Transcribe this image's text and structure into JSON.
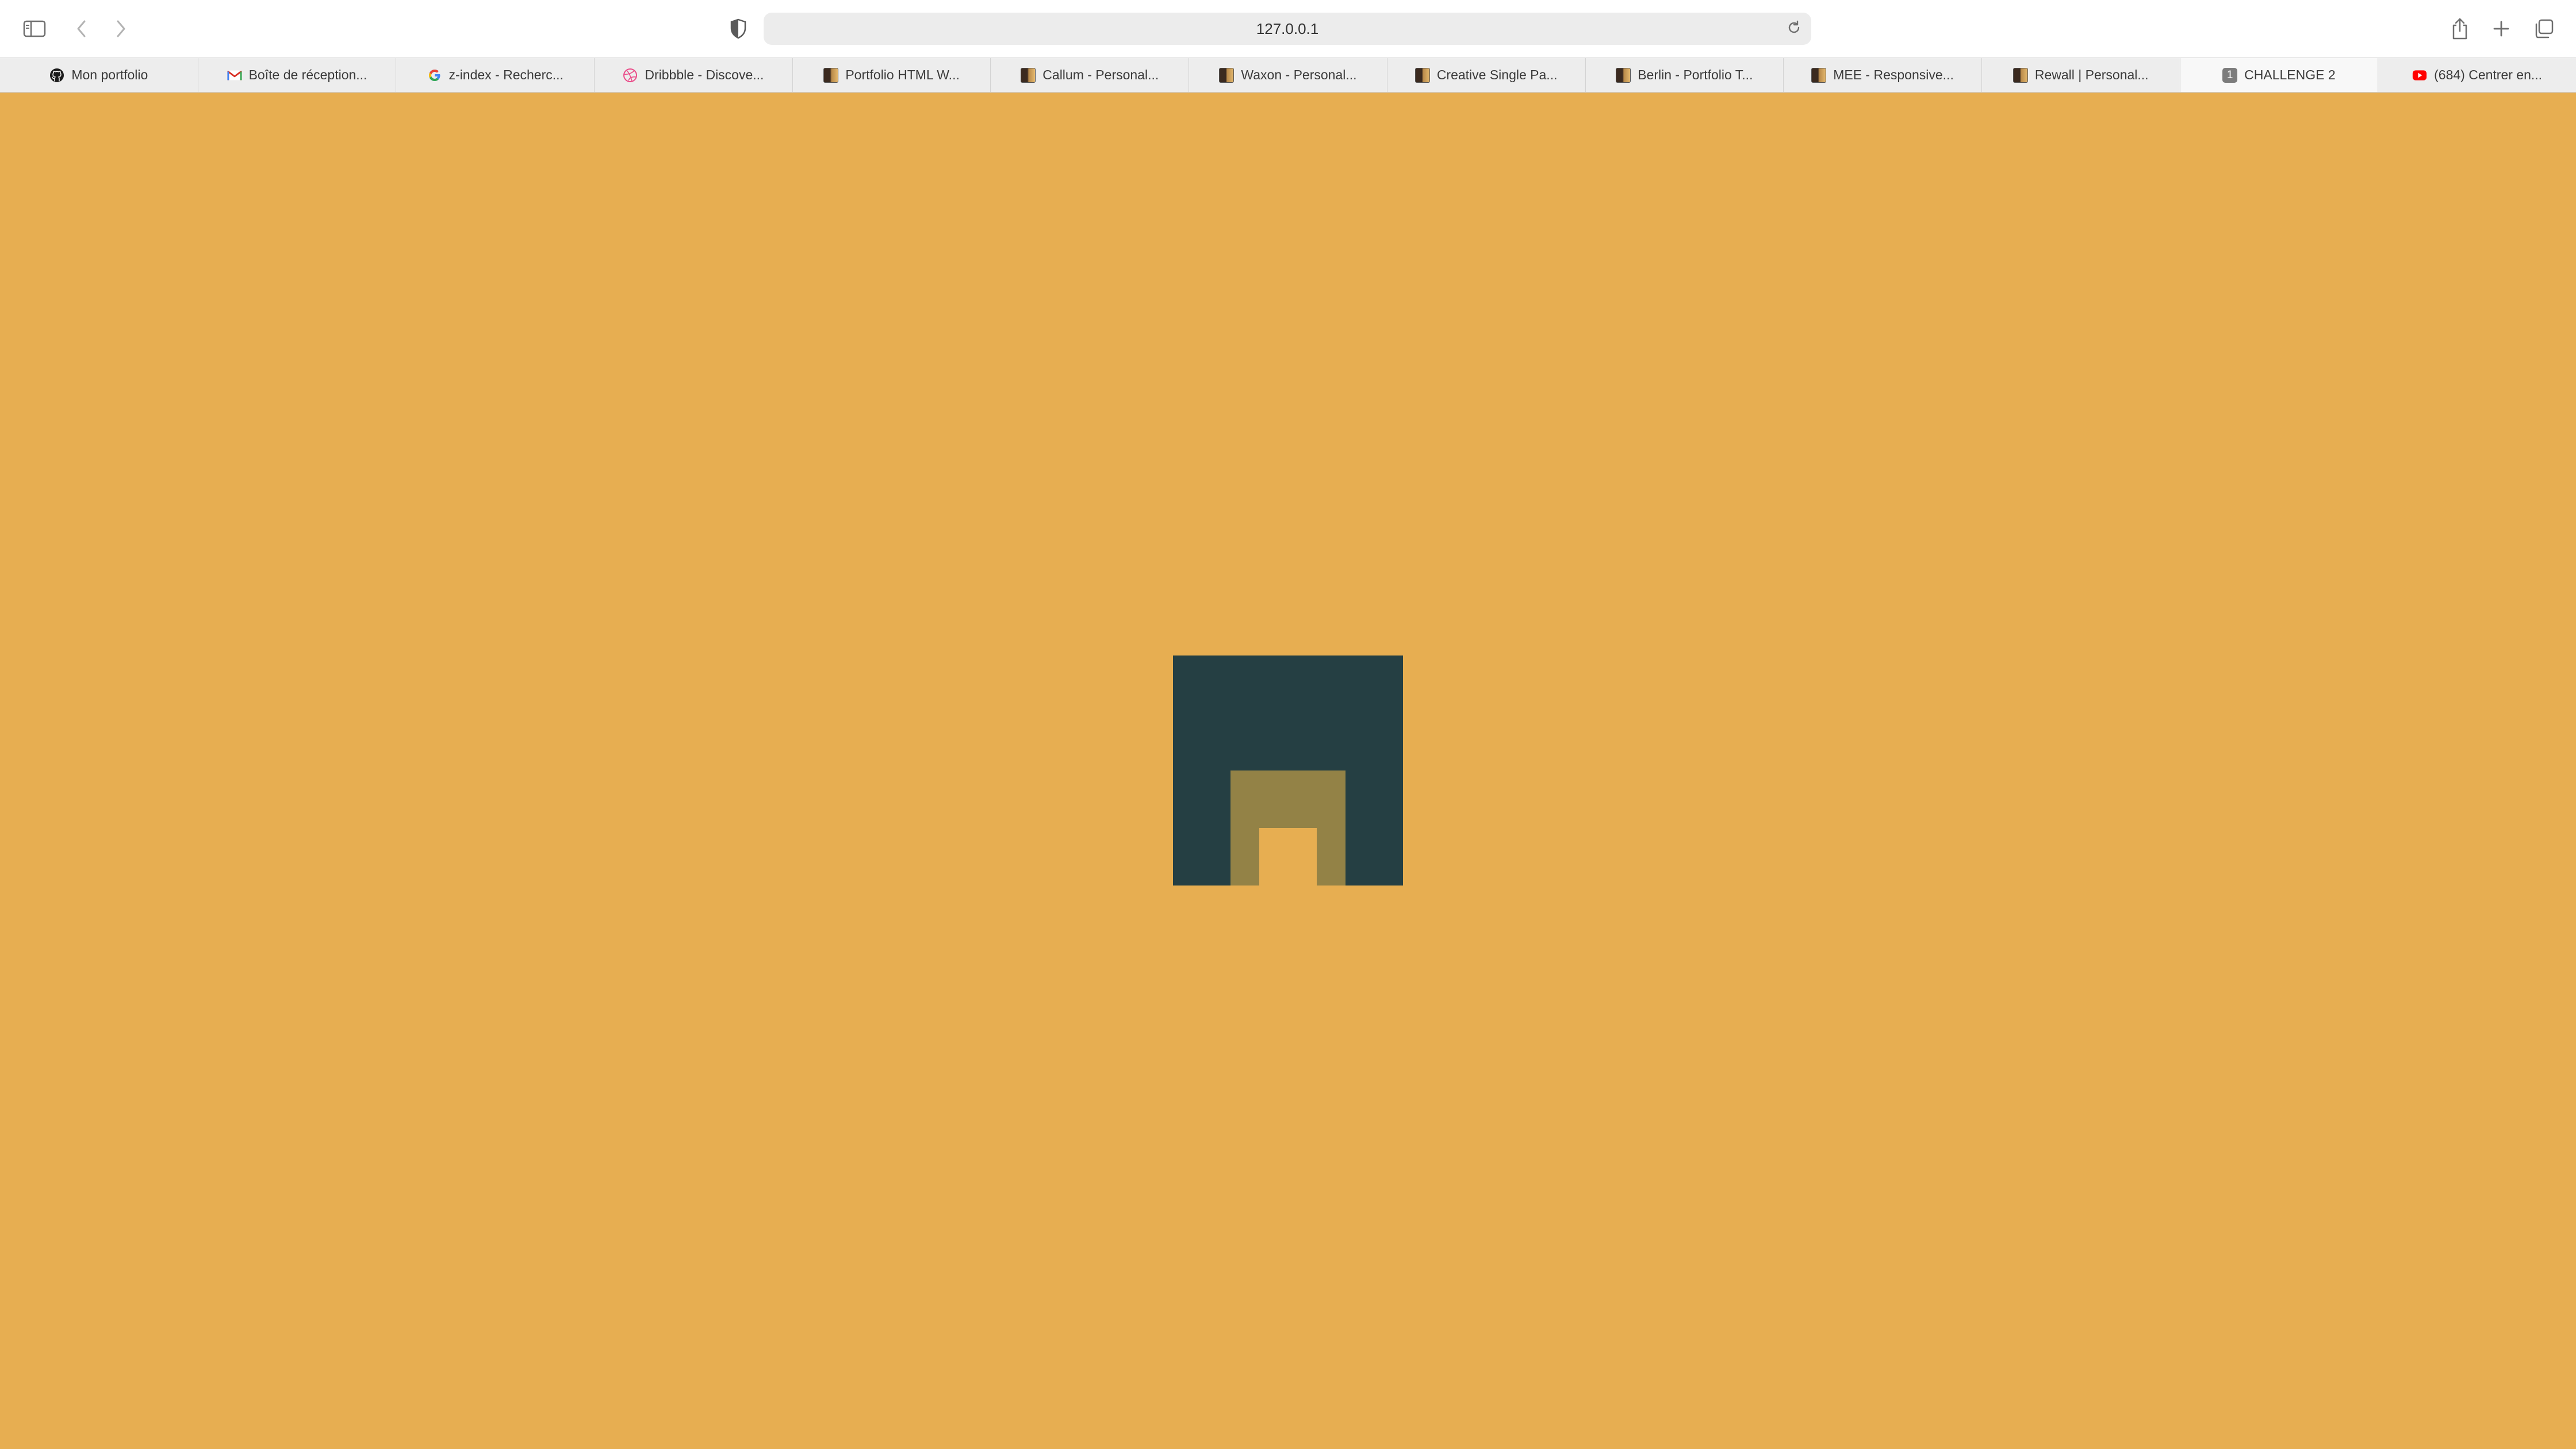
{
  "browser": {
    "address": "127.0.0.1",
    "icons": {
      "sidebar": "sidebar-icon",
      "back": "chevron-left-icon",
      "forward": "chevron-right-icon",
      "privacy": "shield-icon",
      "reload": "reload-icon",
      "share": "share-icon",
      "new_tab": "plus-icon",
      "tab_overview": "tab-overview-icon"
    }
  },
  "tabs": [
    {
      "label": "Mon portfolio",
      "icon": "github-icon"
    },
    {
      "label": "Boîte de réception...",
      "icon": "gmail-icon"
    },
    {
      "label": "z-index - Recherc...",
      "icon": "google-icon"
    },
    {
      "label": "Dribbble - Discove...",
      "icon": "dribbble-icon"
    },
    {
      "label": "Portfolio HTML W...",
      "icon": "portrait-thumbnail-icon"
    },
    {
      "label": "Callum - Personal...",
      "icon": "portrait-thumbnail-icon"
    },
    {
      "label": "Waxon - Personal...",
      "icon": "portrait-thumbnail-icon"
    },
    {
      "label": "Creative Single Pa...",
      "icon": "portrait-thumbnail-icon"
    },
    {
      "label": "Berlin - Portfolio T...",
      "icon": "portrait-thumbnail-icon"
    },
    {
      "label": "MEE - Responsive...",
      "icon": "portrait-thumbnail-icon"
    },
    {
      "label": "Rewall | Personal...",
      "icon": "portrait-thumbnail-icon"
    },
    {
      "label": "CHALLENGE 2",
      "icon": "letter-badge-icon",
      "badge": "1",
      "active": true
    },
    {
      "label": "(684) Centrer en...",
      "icon": "youtube-icon"
    }
  ],
  "page": {
    "colors": {
      "background": "#e7ae51",
      "outer_square": "#253f43",
      "middle_square": "#938246",
      "inner_square": "#e7ae51"
    }
  }
}
